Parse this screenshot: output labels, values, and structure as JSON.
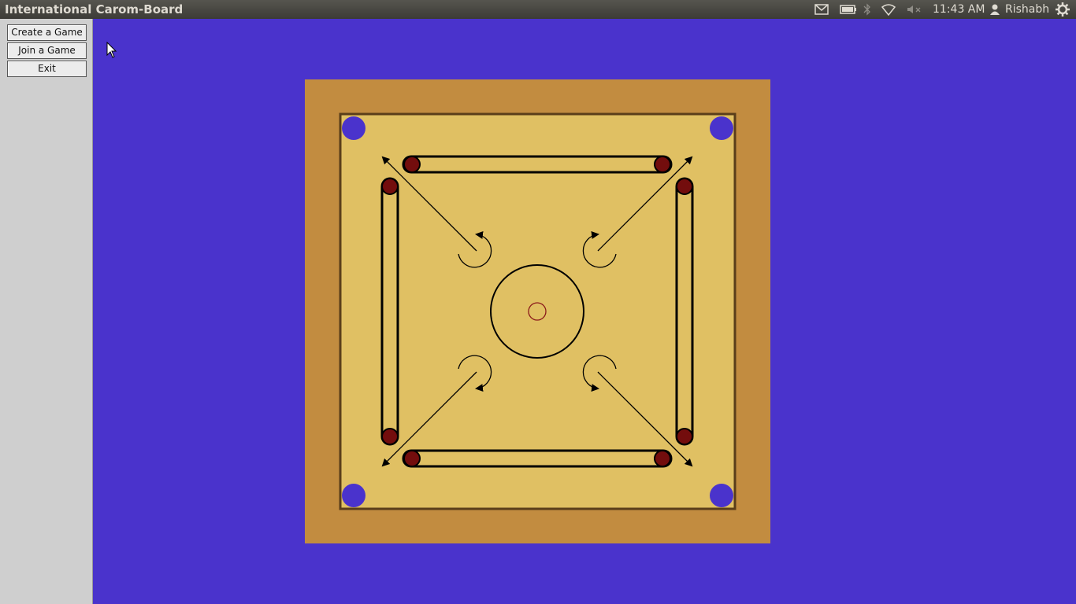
{
  "window": {
    "title": "International Carom-Board"
  },
  "panel": {
    "clock": "11:43 AM",
    "user": "Rishabh",
    "indicators": [
      "mail-icon",
      "battery-icon",
      "bluetooth-icon",
      "wifi-icon",
      "volume-muted-icon",
      "user-icon",
      "power-gear-icon"
    ]
  },
  "sidebar": {
    "buttons": [
      {
        "label": "Create a Game"
      },
      {
        "label": "Join a Game"
      },
      {
        "label": "Exit"
      }
    ]
  },
  "board": {
    "colors": {
      "background": "#4a33cc",
      "frame": "#c28c40",
      "playing_surface": "#e0c063",
      "border_line": "#5a3e1a",
      "pocket": "#4a33cc",
      "baseline_circle": "#730d0d",
      "center_dot": "#8b1a1a"
    }
  }
}
